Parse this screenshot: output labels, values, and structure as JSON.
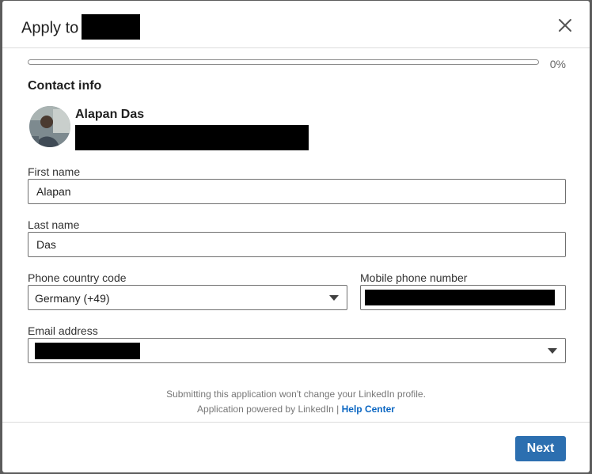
{
  "modal": {
    "title_prefix": "Apply to",
    "title_redacted": true,
    "close_icon": "close-icon"
  },
  "progress": {
    "value": 0,
    "label": "0%"
  },
  "section": {
    "title": "Contact info"
  },
  "profile": {
    "name": "Alapan Das",
    "headline_redacted": true
  },
  "fields": {
    "first_name": {
      "label": "First name",
      "value": "Alapan"
    },
    "last_name": {
      "label": "Last name",
      "value": "Das"
    },
    "phone_country_code": {
      "label": "Phone country code",
      "value": "Germany (+49)"
    },
    "mobile_phone": {
      "label": "Mobile phone number",
      "redacted": true
    },
    "email": {
      "label": "Email address",
      "redacted": true
    }
  },
  "footer_note": {
    "line1": "Submitting this application won't change your LinkedIn profile.",
    "line2": "Application powered by LinkedIn |",
    "help_link": "Help Center"
  },
  "actions": {
    "next_label": "Next"
  },
  "colors": {
    "accent": "#0a66c2",
    "button": "#2c6fb0",
    "backdrop": "#5c5c5c"
  }
}
